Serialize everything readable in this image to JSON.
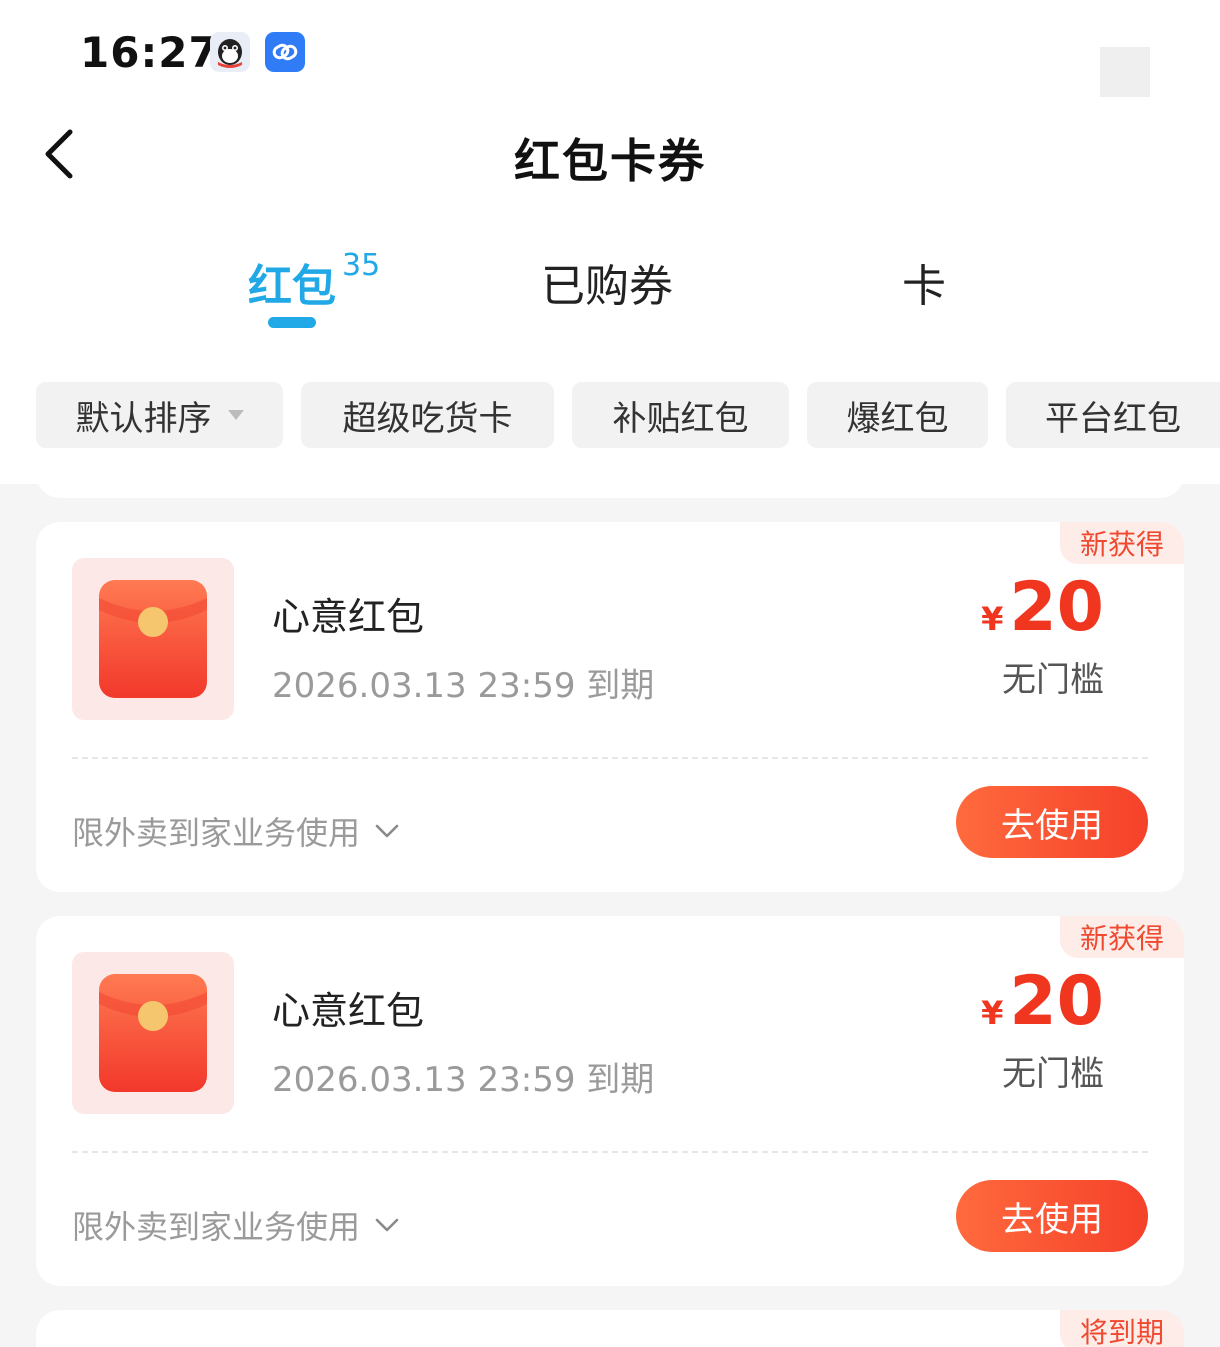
{
  "status_bar": {
    "time": "16:27",
    "icons": [
      "qq-penguin-icon",
      "link-app-icon"
    ]
  },
  "header": {
    "title": "红包卡券",
    "back_icon": "chevron-left-icon"
  },
  "tabs": [
    {
      "label": "红包",
      "badge": "35",
      "active": true
    },
    {
      "label": "已购券",
      "active": false
    },
    {
      "label": "卡",
      "active": false
    }
  ],
  "filters": [
    {
      "label": "默认排序",
      "has_dropdown": true
    },
    {
      "label": "超级吃货卡"
    },
    {
      "label": "补贴红包"
    },
    {
      "label": "爆红包"
    },
    {
      "label": "平台红包"
    }
  ],
  "cards": [
    {
      "tag": "新获得",
      "name": "心意红包",
      "expiry": "2026.03.13 23:59 到期",
      "currency": "¥",
      "amount": "20",
      "threshold": "无门槛",
      "scope": "限外卖到家业务使用",
      "action": "去使用"
    },
    {
      "tag": "新获得",
      "name": "心意红包",
      "expiry": "2026.03.13 23:59 到期",
      "currency": "¥",
      "amount": "20",
      "threshold": "无门槛",
      "scope": "限外卖到家业务使用",
      "action": "去使用"
    },
    {
      "tag": "将到期"
    }
  ],
  "colors": {
    "accent_blue": "#21a8e6",
    "price_red": "#f0361f",
    "button_gradient_start": "#ff6a3d",
    "button_gradient_end": "#f5412a",
    "tag_bg": "#fdece8"
  }
}
